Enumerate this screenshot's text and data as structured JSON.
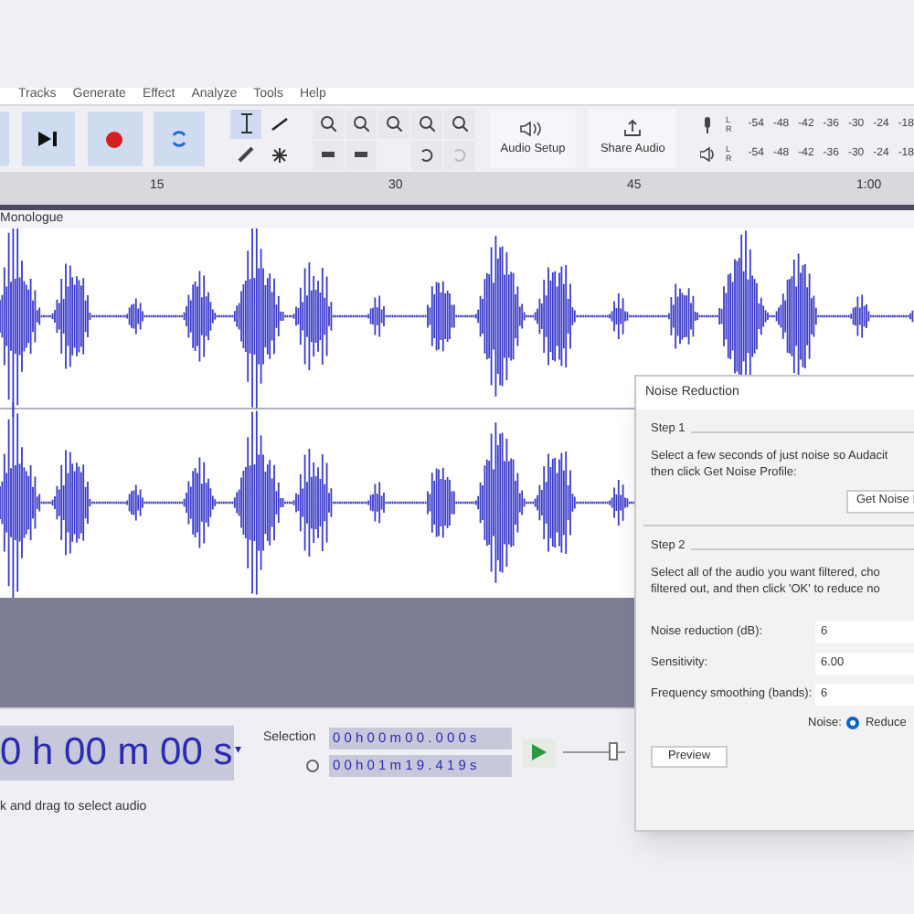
{
  "menu": [
    "Tracks",
    "Generate",
    "Effect",
    "Analyze",
    "Tools",
    "Help"
  ],
  "toolbar": {
    "audio_setup": "Audio Setup",
    "share_audio": "Share Audio",
    "meters": [
      {
        "channels": [
          "L",
          "R"
        ],
        "ticks": [
          "-54",
          "-48",
          "-42",
          "-36",
          "-30",
          "-24",
          "-18"
        ]
      },
      {
        "channels": [
          "L",
          "R"
        ],
        "ticks": [
          "-54",
          "-48",
          "-42",
          "-36",
          "-30",
          "-24",
          "-18"
        ]
      }
    ]
  },
  "ruler": [
    "15",
    "30",
    "45",
    "1:00"
  ],
  "track": {
    "name": "Monologue"
  },
  "dialog": {
    "title": "Noise Reduction",
    "step1": "Step 1",
    "step1_lines": [
      "Select a few seconds of just noise so Audacit",
      "then click Get Noise Profile:"
    ],
    "profile_button": "Get Noise I",
    "step2": "Step 2",
    "step2_lines": [
      "Select all of the audio you want filtered, cho",
      "filtered out, and then click 'OK' to reduce no"
    ],
    "fields": [
      {
        "label": "Noise reduction (dB):",
        "value": "6"
      },
      {
        "label": "Sensitivity:",
        "value": "6.00"
      },
      {
        "label": "Frequency smoothing (bands):",
        "value": "6"
      }
    ],
    "noise": {
      "label": "Noise:",
      "options": [
        {
          "label": "Reduce",
          "selected": true
        }
      ]
    },
    "preview_button": "Preview"
  },
  "time": "0 h 00 m 00 s",
  "time_caret": "▾",
  "play_speed": {
    "level": 0.85
  },
  "selection": {
    "label": "Selection",
    "start": "0 0 h 0 0 m 0 0 . 0 0 0 s",
    "end": "0 0 h 0 1 m 1 9 . 4 1 9 s"
  },
  "status": "k and drag to select audio"
}
